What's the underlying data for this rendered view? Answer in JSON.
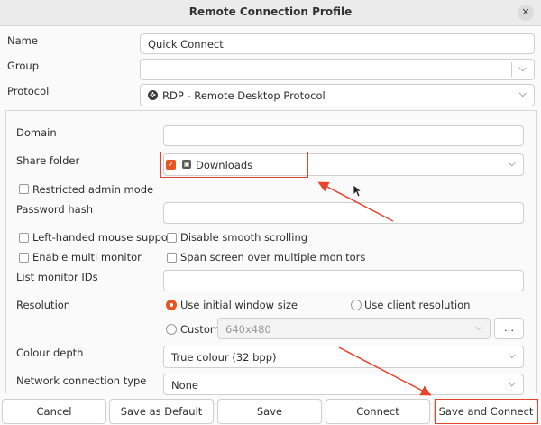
{
  "window": {
    "title": "Remote Connection Profile",
    "close": "✕"
  },
  "form": {
    "name_label": "Name",
    "name_value": "Quick Connect",
    "group_label": "Group",
    "group_value": "",
    "protocol_label": "Protocol",
    "protocol_value": "RDP - Remote Desktop Protocol"
  },
  "settings": {
    "domain_label": "Domain",
    "domain_value": "",
    "share_folder_label": "Share folder",
    "share_folder_checked": true,
    "share_folder_value": "Downloads",
    "restricted_admin_label": "Restricted admin mode",
    "password_hash_label": "Password hash",
    "password_hash_value": "",
    "left_handed_label": "Left-handed mouse support",
    "disable_smooth_label": "Disable smooth scrolling",
    "multi_monitor_label": "Enable multi monitor",
    "span_screen_label": "Span screen over multiple monitors",
    "list_monitor_label": "List monitor IDs",
    "list_monitor_value": "",
    "resolution_label": "Resolution",
    "res_option_initial": "Use initial window size",
    "res_option_client": "Use client resolution",
    "res_option_custom": "Custom",
    "res_selected": "Use initial window size",
    "custom_placeholder": "640x480",
    "custom_more": "...",
    "colour_depth_label": "Colour depth",
    "colour_depth_value": "True colour (32 bpp)",
    "network_label": "Network connection type",
    "network_value": "None"
  },
  "buttons": {
    "cancel": "Cancel",
    "save_default": "Save as Default",
    "save": "Save",
    "connect": "Connect",
    "save_connect": "Save and Connect"
  },
  "colors": {
    "accent": "#e95420",
    "annotation": "#e8442c"
  }
}
